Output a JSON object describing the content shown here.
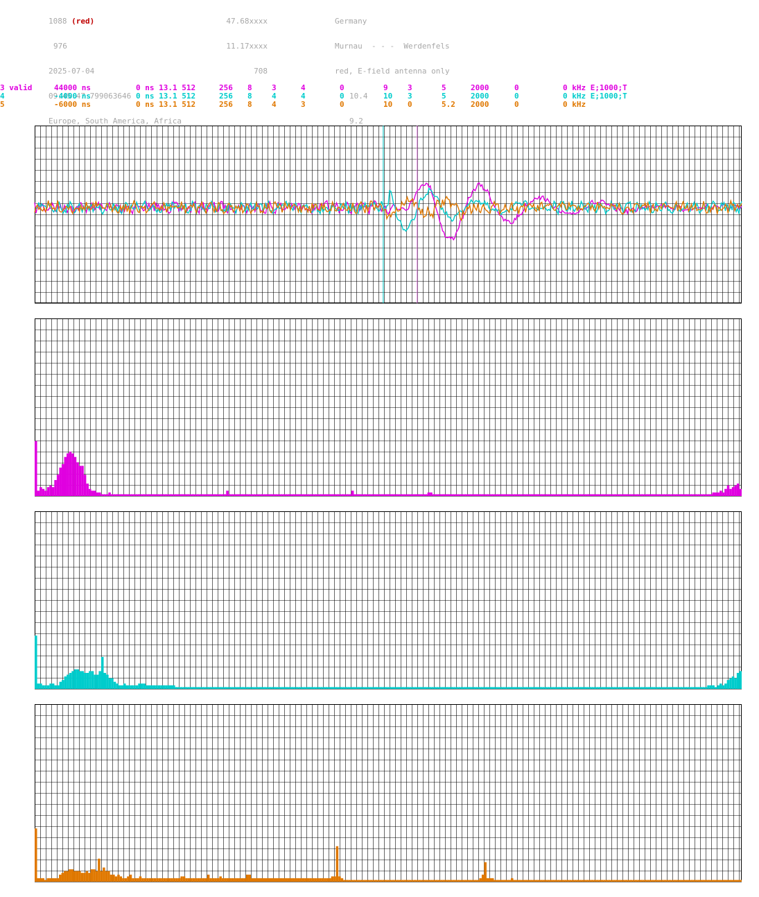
{
  "header": {
    "col1": [
      "1088",
      "976",
      "2025-07-04",
      "09:45:47.799063646",
      "Europe, South America, Africa"
    ],
    "col1_red": "(red)",
    "col2": [
      "47.68xxxx",
      "11.17xxxx",
      "708"
    ],
    "col3": [
      "Germany",
      "Murnau  - - -  Werdenfels",
      "red, E-field antenna only",
      "10.4",
      "9.2"
    ]
  },
  "params": [
    {
      "color": "#e000e0",
      "cells": [
        "3 valid",
        "44000 ns",
        "0 ns 13.1 512",
        "256",
        "8",
        "3",
        "4",
        "0",
        "9",
        "3",
        "5",
        "2000",
        "0",
        "0 kHz E;1000;T"
      ]
    },
    {
      "color": "#00cccc",
      "cells": [
        "4",
        "-4000 ns",
        "0 ns 13.1 512",
        "256",
        "8",
        "4",
        "4",
        "0",
        "10",
        "3",
        "5",
        "2000",
        "0",
        "0 kHz E;1000;T"
      ]
    },
    {
      "color": "#e07800",
      "cells": [
        "5",
        "-6000 ns",
        "0 ns 13.1 512",
        "256",
        "8",
        "4",
        "3",
        "0",
        "10",
        "0",
        "5.2",
        "2000",
        "0",
        "0 kHz"
      ]
    }
  ],
  "chart_data": [
    {
      "type": "line",
      "description": "time-domain waveforms of three sferic recordings",
      "series": [
        {
          "color": "#e000e0",
          "style": "noise then large damped oscillation",
          "peak_index": 0.568
        },
        {
          "color": "#00cccc",
          "style": "noise with oscillation",
          "peak_index": 0.52
        },
        {
          "color": "#e07800",
          "style": "noise",
          "peak_index": 0.49
        }
      ],
      "markers": [
        {
          "color": "#00cccc",
          "pos": 0.493
        },
        {
          "color": "#e070e0",
          "pos": 0.541
        }
      ],
      "grid": true
    },
    {
      "type": "bar",
      "color": "#e000e0",
      "grid": true,
      "values": [
        0.31,
        0.03,
        0.05,
        0.04,
        0.03,
        0.05,
        0.06,
        0.05,
        0.09,
        0.12,
        0.16,
        0.18,
        0.22,
        0.24,
        0.25,
        0.24,
        0.22,
        0.19,
        0.17,
        0.17,
        0.12,
        0.07,
        0.04,
        0.03,
        0.03,
        0.02,
        0.02,
        0.01,
        0.01,
        0.01,
        0.02,
        0.01,
        0.01,
        0.01,
        0.01,
        0.01,
        0.01,
        0.01,
        0.01,
        0.01,
        0.01,
        0.01,
        0.01,
        0.01,
        0.01,
        0.01,
        0.01,
        0.01,
        0.01,
        0.01,
        0.01,
        0.01,
        0.01,
        0.01,
        0.01,
        0.01,
        0.01,
        0.01,
        0.01,
        0.01,
        0.01,
        0.01,
        0.01,
        0.01,
        0.01,
        0.01,
        0.01,
        0.01,
        0.01,
        0.01,
        0.01,
        0.01,
        0.01,
        0.01,
        0.01,
        0.01,
        0.01,
        0.01,
        0.03,
        0.01,
        0.01,
        0.01,
        0.01,
        0.01,
        0.01,
        0.01,
        0.01,
        0.01,
        0.01,
        0.01,
        0.01,
        0.01,
        0.01,
        0.01,
        0.01,
        0.01,
        0.01,
        0.01,
        0.01,
        0.01,
        0.01,
        0.01,
        0.01,
        0.01,
        0.01,
        0.01,
        0.01,
        0.01,
        0.01,
        0.01,
        0.01,
        0.01,
        0.01,
        0.01,
        0.01,
        0.01,
        0.01,
        0.01,
        0.01,
        0.01,
        0.01,
        0.01,
        0.01,
        0.01,
        0.01,
        0.01,
        0.01,
        0.01,
        0.01,
        0.03,
        0.01,
        0.01,
        0.01,
        0.01,
        0.01,
        0.01,
        0.01,
        0.01,
        0.01,
        0.01,
        0.01,
        0.01,
        0.01,
        0.01,
        0.01,
        0.01,
        0.01,
        0.01,
        0.01,
        0.01,
        0.01,
        0.01,
        0.01,
        0.01,
        0.01,
        0.01,
        0.01,
        0.01,
        0.01,
        0.01,
        0.02,
        0.02,
        0.01,
        0.01,
        0.01,
        0.01,
        0.01,
        0.01,
        0.01,
        0.01,
        0.01,
        0.01,
        0.01,
        0.01,
        0.01,
        0.01,
        0.01,
        0.01,
        0.01,
        0.01,
        0.01,
        0.01,
        0.01,
        0.01,
        0.01,
        0.01,
        0.01,
        0.01,
        0.01,
        0.01,
        0.01,
        0.01,
        0.01,
        0.01,
        0.01,
        0.01,
        0.01,
        0.01,
        0.01,
        0.01,
        0.01,
        0.01,
        0.01,
        0.01,
        0.01,
        0.01,
        0.01,
        0.01,
        0.01,
        0.01,
        0.01,
        0.01,
        0.01,
        0.01,
        0.01,
        0.01,
        0.01,
        0.01,
        0.01,
        0.01,
        0.01,
        0.01,
        0.01,
        0.01,
        0.01,
        0.01,
        0.01,
        0.01,
        0.01,
        0.01,
        0.01,
        0.01,
        0.01,
        0.01,
        0.01,
        0.01,
        0.01,
        0.01,
        0.01,
        0.01,
        0.01,
        0.01,
        0.01,
        0.01,
        0.01,
        0.01,
        0.01,
        0.01,
        0.01,
        0.01,
        0.01,
        0.01,
        0.01,
        0.01,
        0.01,
        0.01,
        0.01,
        0.01,
        0.01,
        0.01,
        0.01,
        0.01,
        0.01,
        0.01,
        0.01,
        0.01,
        0.01,
        0.01,
        0.01,
        0.01,
        0.01,
        0.01,
        0.01,
        0.01,
        0.01,
        0.01,
        0.02,
        0.02,
        0.02,
        0.03,
        0.02,
        0.04,
        0.06,
        0.04,
        0.05,
        0.06,
        0.07,
        0.04
      ]
    },
    {
      "type": "bar",
      "color": "#00cccc",
      "grid": true,
      "values": [
        0.3,
        0.03,
        0.03,
        0.02,
        0.02,
        0.02,
        0.03,
        0.03,
        0.02,
        0.02,
        0.04,
        0.05,
        0.07,
        0.08,
        0.09,
        0.1,
        0.11,
        0.11,
        0.1,
        0.1,
        0.09,
        0.09,
        0.1,
        0.1,
        0.08,
        0.08,
        0.1,
        0.18,
        0.09,
        0.08,
        0.06,
        0.06,
        0.04,
        0.03,
        0.02,
        0.02,
        0.03,
        0.02,
        0.02,
        0.02,
        0.02,
        0.02,
        0.03,
        0.03,
        0.03,
        0.02,
        0.02,
        0.02,
        0.02,
        0.02,
        0.02,
        0.02,
        0.02,
        0.02,
        0.02,
        0.02,
        0.02,
        0.01,
        0.01,
        0.01,
        0.01,
        0.01,
        0.01,
        0.01,
        0.01,
        0.01,
        0.01,
        0.01,
        0.01,
        0.01,
        0.01,
        0.01,
        0.01,
        0.01,
        0.01,
        0.01,
        0.01,
        0.01,
        0.01,
        0.01,
        0.01,
        0.01,
        0.01,
        0.01,
        0.01,
        0.01,
        0.01,
        0.01,
        0.01,
        0.01,
        0.01,
        0.01,
        0.01,
        0.01,
        0.01,
        0.01,
        0.01,
        0.01,
        0.01,
        0.01,
        0.01,
        0.01,
        0.01,
        0.01,
        0.01,
        0.01,
        0.01,
        0.01,
        0.01,
        0.01,
        0.01,
        0.01,
        0.01,
        0.01,
        0.01,
        0.01,
        0.01,
        0.01,
        0.01,
        0.01,
        0.01,
        0.01,
        0.01,
        0.01,
        0.01,
        0.01,
        0.01,
        0.01,
        0.01,
        0.01,
        0.01,
        0.01,
        0.01,
        0.01,
        0.01,
        0.01,
        0.01,
        0.01,
        0.01,
        0.01,
        0.01,
        0.01,
        0.01,
        0.01,
        0.01,
        0.01,
        0.01,
        0.01,
        0.01,
        0.01,
        0.01,
        0.01,
        0.01,
        0.01,
        0.01,
        0.01,
        0.01,
        0.01,
        0.01,
        0.01,
        0.01,
        0.01,
        0.01,
        0.01,
        0.01,
        0.01,
        0.01,
        0.01,
        0.01,
        0.01,
        0.01,
        0.01,
        0.01,
        0.01,
        0.01,
        0.01,
        0.01,
        0.01,
        0.01,
        0.01,
        0.01,
        0.01,
        0.01,
        0.01,
        0.01,
        0.01,
        0.01,
        0.01,
        0.01,
        0.01,
        0.01,
        0.01,
        0.01,
        0.01,
        0.01,
        0.01,
        0.01,
        0.01,
        0.01,
        0.01,
        0.01,
        0.01,
        0.01,
        0.01,
        0.01,
        0.01,
        0.01,
        0.01,
        0.01,
        0.01,
        0.01,
        0.01,
        0.01,
        0.01,
        0.01,
        0.01,
        0.01,
        0.01,
        0.01,
        0.01,
        0.01,
        0.01,
        0.01,
        0.01,
        0.01,
        0.01,
        0.01,
        0.01,
        0.01,
        0.01,
        0.01,
        0.01,
        0.01,
        0.01,
        0.01,
        0.01,
        0.01,
        0.01,
        0.01,
        0.01,
        0.01,
        0.01,
        0.01,
        0.01,
        0.01,
        0.01,
        0.01,
        0.01,
        0.01,
        0.01,
        0.01,
        0.01,
        0.01,
        0.01,
        0.01,
        0.01,
        0.01,
        0.01,
        0.01,
        0.01,
        0.01,
        0.01,
        0.01,
        0.01,
        0.01,
        0.01,
        0.01,
        0.01,
        0.01,
        0.01,
        0.01,
        0.01,
        0.01,
        0.02,
        0.02,
        0.02,
        0.01,
        0.02,
        0.03,
        0.02,
        0.03,
        0.05,
        0.06,
        0.07,
        0.06,
        0.09,
        0.1
      ]
    },
    {
      "type": "bar",
      "color": "#e07800",
      "grid": true,
      "values": [
        0.3,
        0.02,
        0.02,
        0.02,
        0.01,
        0.02,
        0.02,
        0.02,
        0.02,
        0.02,
        0.04,
        0.05,
        0.06,
        0.06,
        0.07,
        0.07,
        0.06,
        0.06,
        0.06,
        0.05,
        0.05,
        0.06,
        0.05,
        0.07,
        0.07,
        0.06,
        0.13,
        0.06,
        0.08,
        0.06,
        0.06,
        0.04,
        0.04,
        0.03,
        0.04,
        0.03,
        0.02,
        0.02,
        0.03,
        0.04,
        0.02,
        0.02,
        0.02,
        0.03,
        0.02,
        0.02,
        0.02,
        0.02,
        0.02,
        0.02,
        0.02,
        0.02,
        0.02,
        0.02,
        0.02,
        0.02,
        0.02,
        0.02,
        0.02,
        0.02,
        0.03,
        0.03,
        0.02,
        0.02,
        0.02,
        0.02,
        0.02,
        0.02,
        0.02,
        0.02,
        0.02,
        0.04,
        0.02,
        0.02,
        0.02,
        0.02,
        0.03,
        0.02,
        0.02,
        0.02,
        0.02,
        0.02,
        0.02,
        0.02,
        0.02,
        0.02,
        0.02,
        0.04,
        0.04,
        0.02,
        0.02,
        0.02,
        0.02,
        0.02,
        0.02,
        0.02,
        0.02,
        0.02,
        0.02,
        0.02,
        0.02,
        0.02,
        0.02,
        0.02,
        0.02,
        0.02,
        0.02,
        0.02,
        0.02,
        0.02,
        0.02,
        0.02,
        0.02,
        0.02,
        0.02,
        0.02,
        0.02,
        0.02,
        0.02,
        0.02,
        0.02,
        0.02,
        0.03,
        0.03,
        0.2,
        0.03,
        0.02,
        0.01,
        0.01,
        0.01,
        0.01,
        0.01,
        0.01,
        0.01,
        0.01,
        0.01,
        0.01,
        0.01,
        0.01,
        0.01,
        0.01,
        0.01,
        0.01,
        0.01,
        0.01,
        0.01,
        0.01,
        0.01,
        0.01,
        0.01,
        0.01,
        0.01,
        0.01,
        0.01,
        0.01,
        0.01,
        0.01,
        0.01,
        0.01,
        0.01,
        0.01,
        0.01,
        0.01,
        0.01,
        0.01,
        0.01,
        0.01,
        0.01,
        0.01,
        0.01,
        0.01,
        0.01,
        0.01,
        0.01,
        0.01,
        0.01,
        0.01,
        0.01,
        0.01,
        0.01,
        0.01,
        0.01,
        0.01,
        0.02,
        0.04,
        0.11,
        0.02,
        0.02,
        0.02,
        0.01,
        0.01,
        0.01,
        0.01,
        0.01,
        0.01,
        0.01,
        0.02,
        0.01,
        0.01,
        0.01,
        0.01,
        0.01,
        0.01,
        0.01,
        0.01,
        0.01,
        0.01,
        0.01,
        0.01,
        0.01,
        0.01,
        0.01,
        0.01,
        0.01,
        0.01,
        0.01,
        0.01,
        0.01,
        0.01,
        0.01,
        0.01,
        0.01,
        0.01,
        0.01,
        0.01,
        0.01,
        0.01,
        0.01,
        0.01,
        0.01,
        0.01,
        0.01,
        0.01,
        0.01,
        0.01,
        0.01,
        0.01,
        0.01,
        0.01,
        0.01,
        0.01,
        0.01,
        0.01,
        0.01,
        0.01,
        0.01,
        0.01,
        0.01,
        0.01,
        0.01,
        0.01,
        0.01,
        0.01,
        0.01,
        0.01,
        0.01,
        0.01,
        0.01,
        0.01,
        0.01,
        0.01,
        0.01,
        0.01,
        0.01,
        0.01,
        0.01,
        0.01,
        0.01,
        0.01,
        0.01,
        0.01,
        0.01,
        0.01,
        0.01,
        0.01,
        0.01,
        0.01,
        0.01,
        0.01,
        0.01,
        0.01,
        0.01,
        0.01,
        0.01,
        0.01,
        0.01,
        0.01,
        0.01,
        0.01,
        0.01,
        0.01
      ]
    }
  ]
}
